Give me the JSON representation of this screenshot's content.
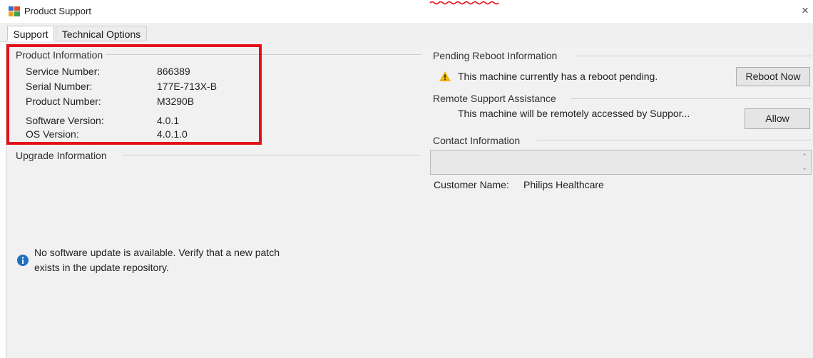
{
  "window": {
    "title": "Product Support",
    "close_symbol": "×",
    "app_icon": "product-support-app-icon"
  },
  "tabs": [
    {
      "label": "Support",
      "active": true
    },
    {
      "label": "Technical Options",
      "active": false
    }
  ],
  "product_info": {
    "title": "Product Information",
    "rows": [
      {
        "label": "Service Number:",
        "value": "866389"
      },
      {
        "label": "Serial Number:",
        "value": "177E-713X-B"
      },
      {
        "label": "Product Number:",
        "value": "M3290B"
      },
      {
        "label": "Software Version:",
        "value": "4.0.1"
      },
      {
        "label": "OS Version:",
        "value": "4.0.1.0"
      }
    ]
  },
  "upgrade_info": {
    "title": "Upgrade Information",
    "message_line1": "No software update is available. Verify that a new patch",
    "message_line2": "exists in the update repository.",
    "icon": "info-icon"
  },
  "pending_reboot": {
    "title": "Pending Reboot Information",
    "message": "This machine currently has a reboot pending.",
    "button": "Reboot Now",
    "icon": "warning-icon"
  },
  "remote_support": {
    "title": "Remote Support Assistance",
    "message": "This machine will be remotely accessed by Suppor...",
    "button": "Allow"
  },
  "contact_info": {
    "title": "Contact Information",
    "field_value": "",
    "customer_label": "Customer Name:",
    "customer_value": "Philips Healthcare"
  },
  "colors": {
    "highlight_border": "#e3101a",
    "info_icon": "#1f6fc4",
    "warning_icon": "#f2b705"
  }
}
